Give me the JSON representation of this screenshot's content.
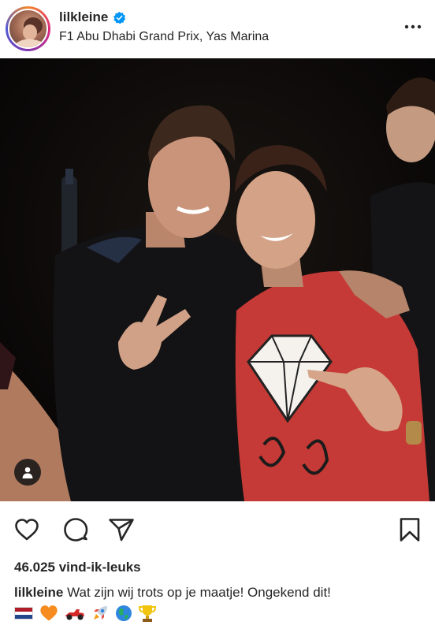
{
  "post": {
    "username": "lilkleine",
    "location": "F1 Abu Dhabi Grand Prix, Yas Marina",
    "likes": "46.025 vind-ik-leuks",
    "caption_user": "lilkleine",
    "caption_text": "Wat zijn wij trots op je maatje! Ongekend dit!",
    "caption_emojis": [
      "🇳🇱",
      "🧡",
      "🏎",
      "🚀",
      "🌎",
      "🏆"
    ]
  },
  "icons": {
    "verified": "verified-badge-icon",
    "more": "more-options-icon",
    "like": "heart-icon",
    "comment": "comment-icon",
    "share": "paper-plane-icon",
    "save": "bookmark-icon",
    "tag": "user-tag-icon"
  },
  "colors": {
    "verified_blue": "#0095f6",
    "text": "#262626"
  }
}
